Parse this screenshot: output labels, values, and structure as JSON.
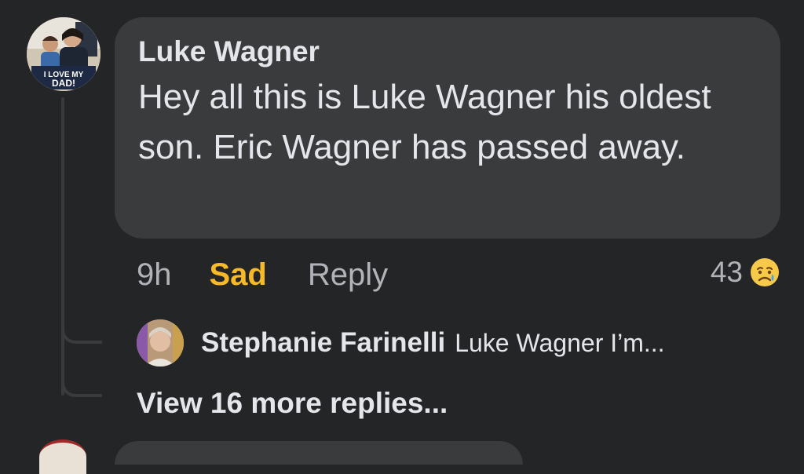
{
  "comment": {
    "author": "Luke Wagner",
    "text": "Hey all this is Luke Wagner his oldest son. Eric Wagner has passed away.",
    "avatar_caption_1": "I LOVE MY",
    "avatar_caption_2": "DAD!",
    "timestamp": "9h",
    "reaction_label": "Sad",
    "reply_label": "Reply",
    "reaction_count": "43",
    "reaction_icon": "sad-face-emoji"
  },
  "reply_preview": {
    "author": "Stephanie Farinelli",
    "text": "Luke Wagner I’m..."
  },
  "view_more": {
    "label": "View 16 more replies..."
  },
  "colors": {
    "background": "#242526",
    "bubble": "#3a3b3c",
    "primary_text": "#e4e6eb",
    "secondary_text": "#b0b3b8",
    "sad_accent": "#f7b928"
  }
}
